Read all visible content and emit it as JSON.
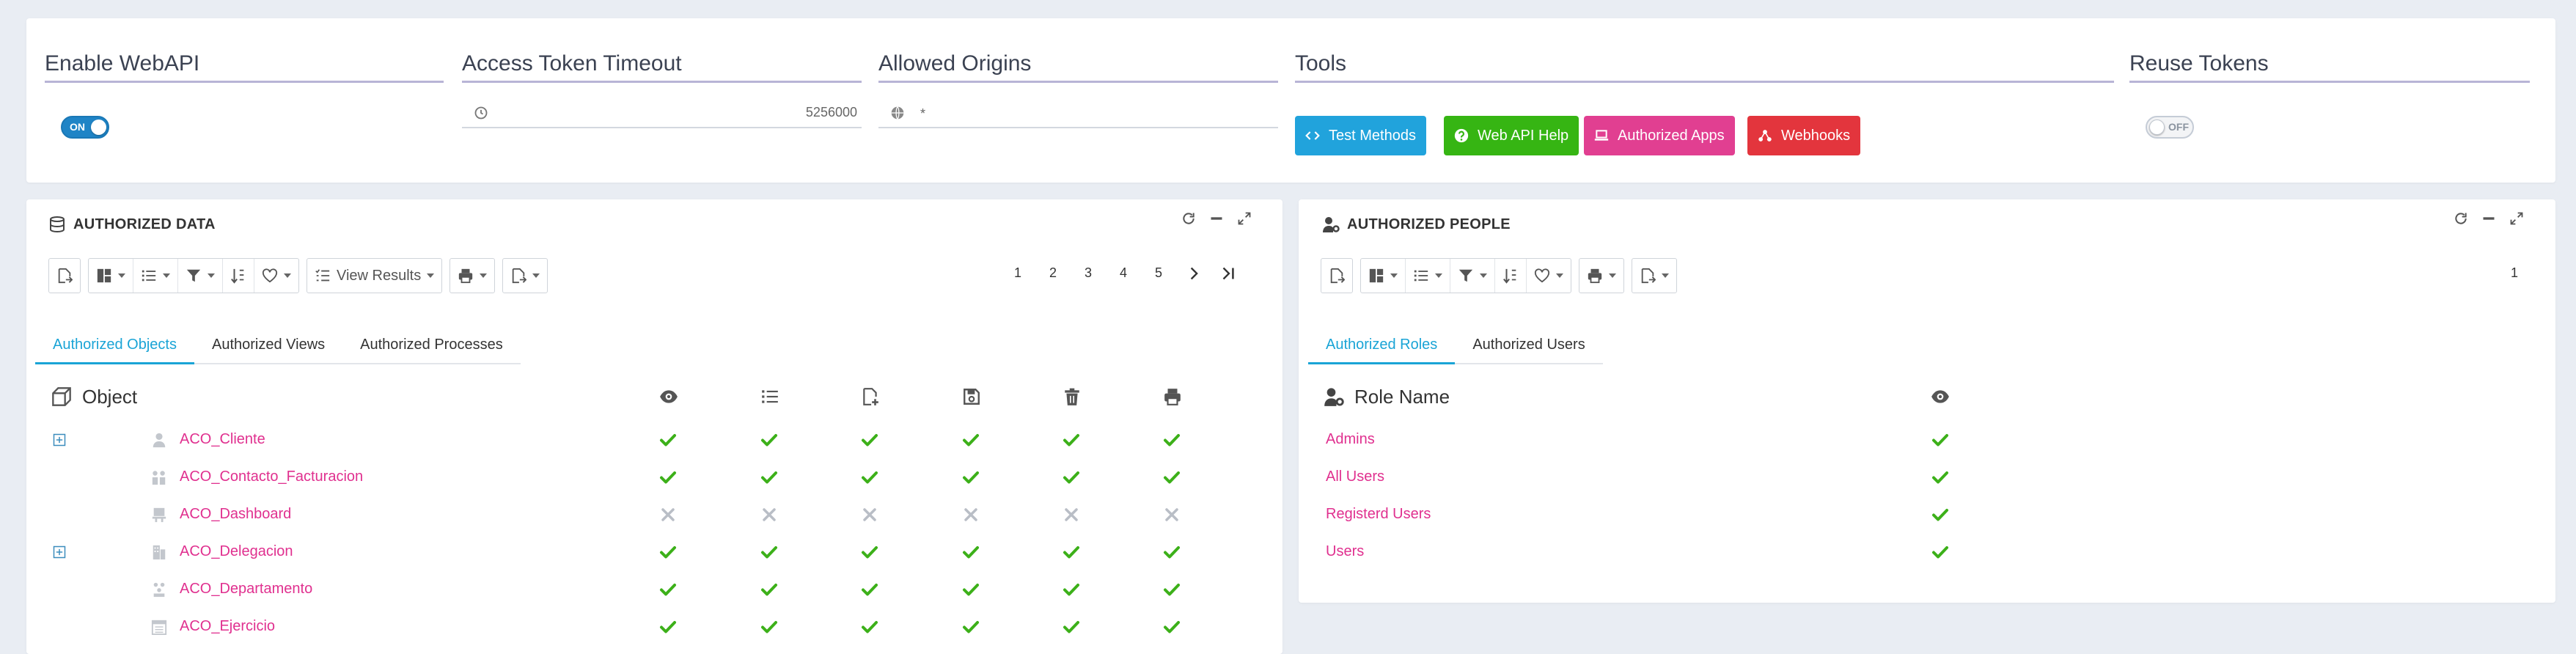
{
  "settings": {
    "enable_webapi": {
      "label": "Enable WebAPI",
      "state": "ON"
    },
    "token_timeout": {
      "label": "Access Token Timeout",
      "value": "5256000"
    },
    "allowed_origins": {
      "label": "Allowed Origins",
      "value": "*"
    },
    "tools": {
      "label": "Tools",
      "buttons": [
        {
          "label": "Test Methods",
          "color": "#21a3dc",
          "icon": "code-icon"
        },
        {
          "label": "Web API Help",
          "color": "#36b513",
          "icon": "help-circle-icon"
        },
        {
          "label": "Authorized Apps",
          "color": "#e13f91",
          "icon": "laptop-icon"
        },
        {
          "label": "Webhooks",
          "color": "#e3353d",
          "icon": "webhook-icon"
        }
      ]
    },
    "reuse_tokens": {
      "label": "Reuse Tokens",
      "state": "OFF"
    }
  },
  "authorized_data": {
    "title": "AUTHORIZED DATA",
    "view_results": "View Results",
    "pages": [
      "1",
      "2",
      "3",
      "4",
      "5"
    ],
    "tabs": [
      "Authorized Objects",
      "Authorized Views",
      "Authorized Processes"
    ],
    "column_header": "Object",
    "permission_icons": [
      "eye-icon",
      "list-icon",
      "new-file-icon",
      "save-icon",
      "trash-icon",
      "print-icon"
    ],
    "rows": [
      {
        "name": "ACO_Cliente",
        "icon": "user-icon",
        "expandable": true,
        "perms": [
          true,
          true,
          true,
          true,
          true,
          true
        ]
      },
      {
        "name": "ACO_Contacto_Facturacion",
        "icon": "users-icon",
        "expandable": false,
        "perms": [
          true,
          true,
          true,
          true,
          true,
          true
        ]
      },
      {
        "name": "ACO_Dashboard",
        "icon": "dashboard-icon",
        "expandable": false,
        "perms": [
          false,
          false,
          false,
          false,
          false,
          false
        ]
      },
      {
        "name": "ACO_Delegacion",
        "icon": "building-icon",
        "expandable": true,
        "perms": [
          true,
          true,
          true,
          true,
          true,
          true
        ]
      },
      {
        "name": "ACO_Departamento",
        "icon": "department-icon",
        "expandable": false,
        "perms": [
          true,
          true,
          true,
          true,
          true,
          true
        ]
      },
      {
        "name": "ACO_Ejercicio",
        "icon": "calendar-icon",
        "expandable": false,
        "perms": [
          true,
          true,
          true,
          true,
          true,
          true
        ]
      }
    ]
  },
  "authorized_people": {
    "title": "AUTHORIZED PEOPLE",
    "pages": [
      "1"
    ],
    "tabs": [
      "Authorized Roles",
      "Authorized Users"
    ],
    "column_header": "Role Name",
    "rows": [
      {
        "name": "Admins",
        "perm": true
      },
      {
        "name": "All Users",
        "perm": true
      },
      {
        "name": "Registerd Users",
        "perm": true
      },
      {
        "name": "Users",
        "perm": true
      }
    ]
  },
  "colors": {
    "check": "#3cb019",
    "cross": "#b9bec6",
    "link": "#e0308f",
    "tab_active": "#1aa4d6",
    "toggle_on": "#1f84c6"
  }
}
